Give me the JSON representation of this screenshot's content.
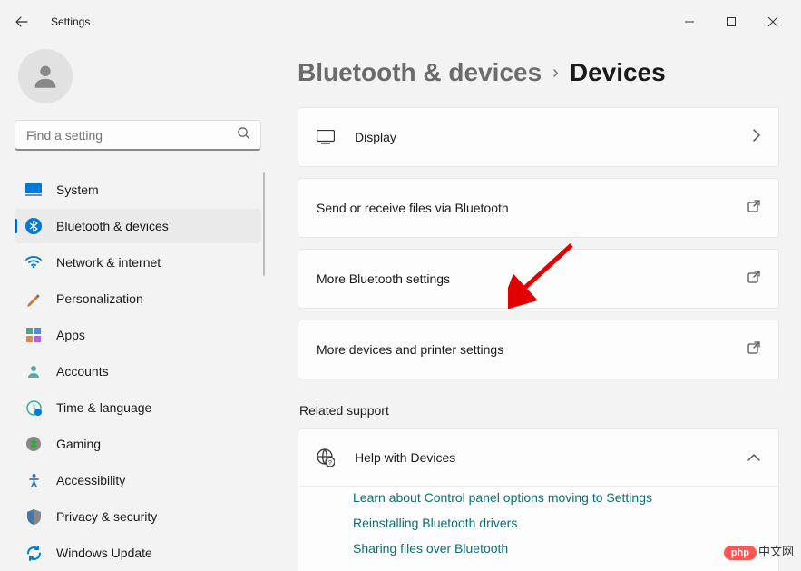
{
  "window": {
    "title": "Settings"
  },
  "search": {
    "placeholder": "Find a setting"
  },
  "nav": [
    {
      "label": "System",
      "icon": "system"
    },
    {
      "label": "Bluetooth & devices",
      "icon": "bluetooth",
      "active": true
    },
    {
      "label": "Network & internet",
      "icon": "wifi"
    },
    {
      "label": "Personalization",
      "icon": "paint"
    },
    {
      "label": "Apps",
      "icon": "apps"
    },
    {
      "label": "Accounts",
      "icon": "person"
    },
    {
      "label": "Time & language",
      "icon": "clock"
    },
    {
      "label": "Gaming",
      "icon": "gaming"
    },
    {
      "label": "Accessibility",
      "icon": "access"
    },
    {
      "label": "Privacy & security",
      "icon": "shield"
    },
    {
      "label": "Windows Update",
      "icon": "update"
    }
  ],
  "breadcrumb": {
    "parent": "Bluetooth & devices",
    "current": "Devices"
  },
  "cards": {
    "display": "Display",
    "send_recv": "Send or receive files via Bluetooth",
    "more_bt": "More Bluetooth settings",
    "more_devices": "More devices and printer settings"
  },
  "related": {
    "title": "Related support",
    "help_header": "Help with Devices",
    "links": [
      "Learn about Control panel options moving to Settings",
      "Reinstalling Bluetooth drivers",
      "Sharing files over Bluetooth"
    ]
  },
  "watermark": {
    "pill": "php",
    "text": "中文网"
  }
}
